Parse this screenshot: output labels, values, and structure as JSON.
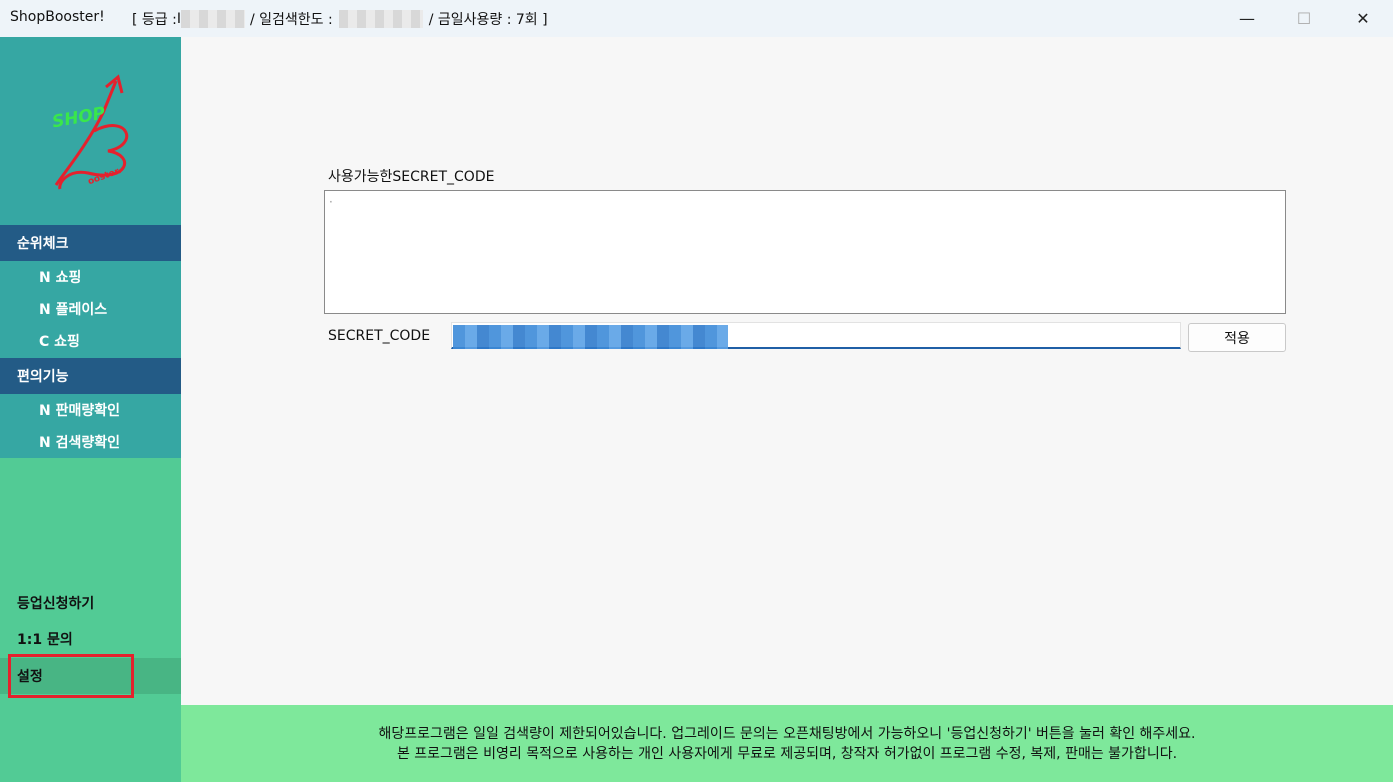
{
  "titlebar": {
    "app_name": "ShopBooster!",
    "grade_label": "[ 등급 : ",
    "grade_value_partial": "I",
    "daily_limit_label": "/ 일검색한도 :",
    "usage_label": "/ 금일사용량 : 7회 ]",
    "minimize_icon": "—",
    "maximize_icon": "☐",
    "close_icon": "✕"
  },
  "sidebar": {
    "logo_text_top": "SHOP",
    "logo_text_bottom": "ooster.",
    "sections": [
      {
        "title": "순위체크",
        "items": [
          "N 쇼핑",
          "N 플레이스",
          "C 쇼핑"
        ]
      },
      {
        "title": "편의기능",
        "items": [
          "N 판매량확인",
          "N 검색량확인"
        ]
      }
    ],
    "bottom_items": [
      "등업신청하기",
      "1:1 문의",
      "설정"
    ]
  },
  "main": {
    "secret_list_label": "사용가능한SECRET_CODE",
    "secret_list_value": "·",
    "code_label": "SECRET_CODE",
    "apply_button": "적용"
  },
  "footer": {
    "line1": "해당프로그램은 일일 검색량이 제한되어있습니다. 업그레이드 문의는 오픈채팅방에서 가능하오니 '등업신청하기' 버튼을 눌러 확인 해주세요.",
    "line2": "본 프로그램은 비영리 목적으로 사용하는 개인 사용자에게 무료로 제공되며, 창작자 허가없이 프로그램 수정, 복제, 판매는 불가합니다."
  },
  "colors": {
    "sidebar_top": "#36a7a3",
    "sidebar_bottom": "#52cb95",
    "section_header": "#235b86",
    "footer": "#7ee89b",
    "highlight": "#e5212d"
  }
}
